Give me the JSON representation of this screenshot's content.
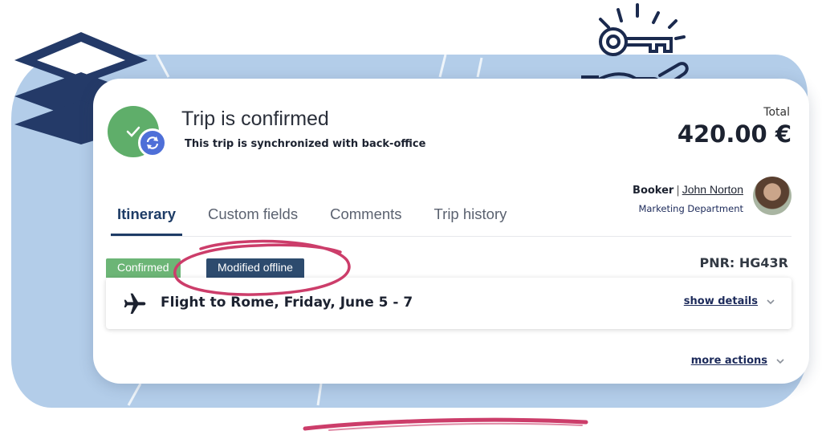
{
  "header": {
    "title": "Trip is confirmed",
    "subtitle": "This trip is synchronized with back-office",
    "status_icons": [
      "check-icon",
      "sync-icon"
    ]
  },
  "total": {
    "label": "Total",
    "value": "420.00 €"
  },
  "booker": {
    "role": "Booker",
    "separator": "|",
    "name": "John Norton",
    "department": "Marketing Department"
  },
  "tabs": [
    {
      "label": "Itinerary",
      "active": true
    },
    {
      "label": "Custom fields",
      "active": false
    },
    {
      "label": "Comments",
      "active": false
    },
    {
      "label": "Trip history",
      "active": false
    }
  ],
  "badges": {
    "confirmed": "Confirmed",
    "modified": "Modified offline"
  },
  "pnr": "PNR: HG43R",
  "flight": {
    "icon": "airplane-icon",
    "title": "Flight to Rome, Friday, June 5 - 7",
    "details_link": "show details"
  },
  "more_actions": "more actions",
  "colors": {
    "confirmed_green": "#6cb576",
    "modified_navy": "#2d4b6e",
    "sync_blue": "#4e6fd8",
    "background_blue": "#b3cde9",
    "highlight_pink": "#cc3d6a"
  }
}
